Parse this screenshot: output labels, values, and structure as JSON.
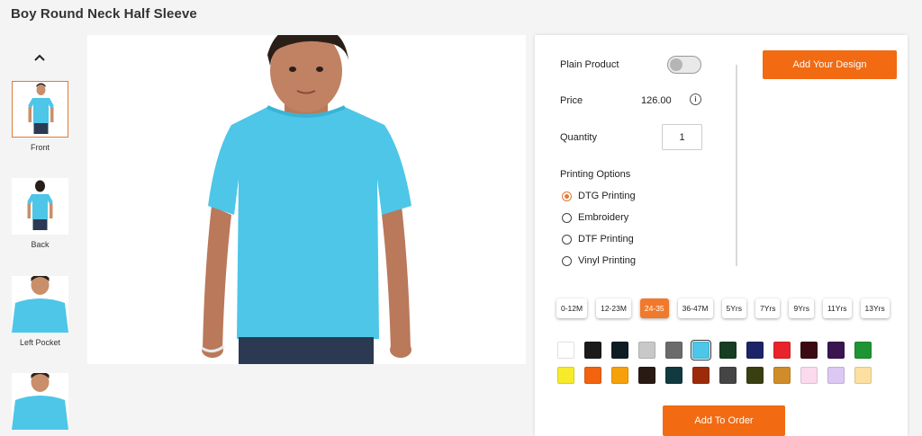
{
  "page": {
    "title": "Boy Round Neck Half Sleeve"
  },
  "thumbnails": [
    {
      "label": "Front",
      "active": true
    },
    {
      "label": "Back",
      "active": false
    },
    {
      "label": "Left Pocket",
      "active": false
    },
    {
      "label": "",
      "active": false
    }
  ],
  "product": {
    "shirt_color": "#4dc6e8"
  },
  "panel": {
    "plain_product_label": "Plain Product",
    "plain_product_on": false,
    "price_label": "Price",
    "price_value": "126.00",
    "info_glyph": "i",
    "quantity_label": "Quantity",
    "quantity_value": "1",
    "printing_label": "Printing Options",
    "printing_options": [
      "DTG Printing",
      "Embroidery",
      "DTF Printing",
      "Vinyl Printing"
    ],
    "printing_selected": 0,
    "add_design_label": "Add Your Design",
    "sizes": [
      "0-12M",
      "12-23M",
      "24-35",
      "36-47M",
      "5Yrs",
      "7Yrs",
      "9Yrs",
      "11Yrs",
      "13Yrs"
    ],
    "size_selected": 2,
    "colors_row1": [
      "#ffffff",
      "#1b1b1b",
      "#0e1c24",
      "#c8c8c8",
      "#6b6b6b",
      "#4dc6e8",
      "#173d22",
      "#1a2466",
      "#e8232a",
      "#3d0a14",
      "#3a1550",
      "#1e9433"
    ],
    "colors_row2": [
      "#f7ea2a",
      "#f2620f",
      "#f7a10a",
      "#2a1a14",
      "#12393f",
      "#9c2b0c",
      "#454545",
      "#3a3f12",
      "#cf8c2a",
      "#fbdaf0",
      "#dcc8f2",
      "#fbe0a2"
    ],
    "color_selected": 5,
    "add_to_order_label": "Add To Order"
  }
}
